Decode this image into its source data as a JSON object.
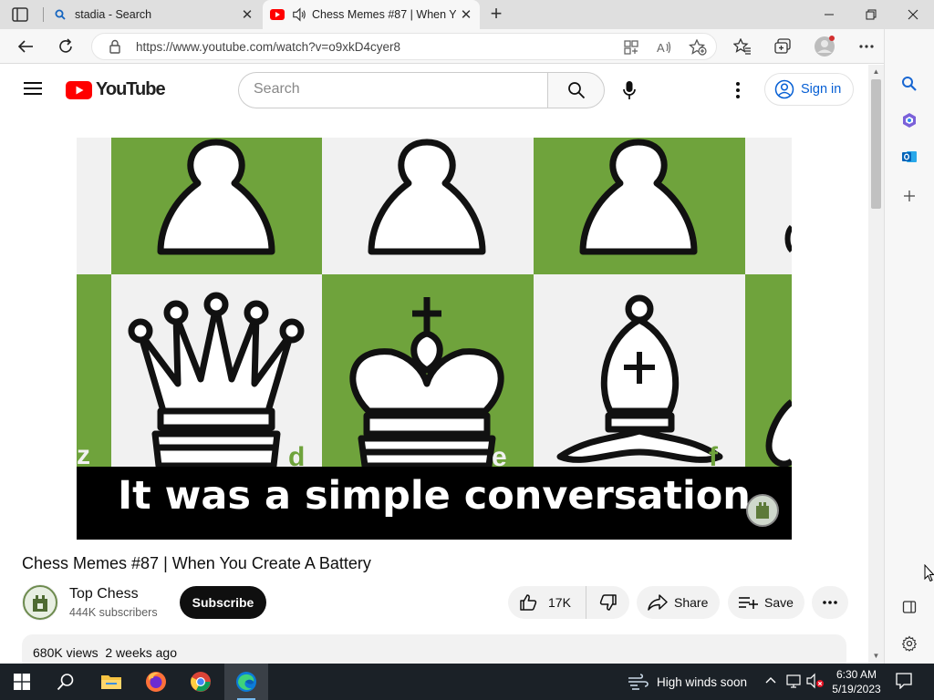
{
  "browser": {
    "tabs": [
      {
        "title": "stadia - Search",
        "active": false
      },
      {
        "title": "Chess Memes #87 | When Y",
        "active": true
      }
    ],
    "url": "https://www.youtube.com/watch?v=o9xkD4cyer8"
  },
  "youtube": {
    "logo_text": "YouTube",
    "search_placeholder": "Search",
    "sign_in_label": "Sign in",
    "video": {
      "caption": "It was a simple conversation",
      "board_file_labels": [
        "d",
        "e",
        "f"
      ]
    },
    "title": "Chess Memes #87 | When You Create A Battery",
    "channel": {
      "name": "Top Chess",
      "subscribers": "444K subscribers"
    },
    "subscribe_label": "Subscribe",
    "likes": "17K",
    "share_label": "Share",
    "save_label": "Save",
    "views": "680K views",
    "age": "2 weeks ago"
  },
  "taskbar": {
    "weather": "High winds soon",
    "time": "6:30 AM",
    "date": "5/19/2023"
  },
  "colors": {
    "youtube_red": "#ff0000",
    "board_green": "#6fa33c",
    "board_light": "#f1f1f1",
    "link_blue": "#065fd4",
    "taskbar_bg": "#1b2127"
  }
}
